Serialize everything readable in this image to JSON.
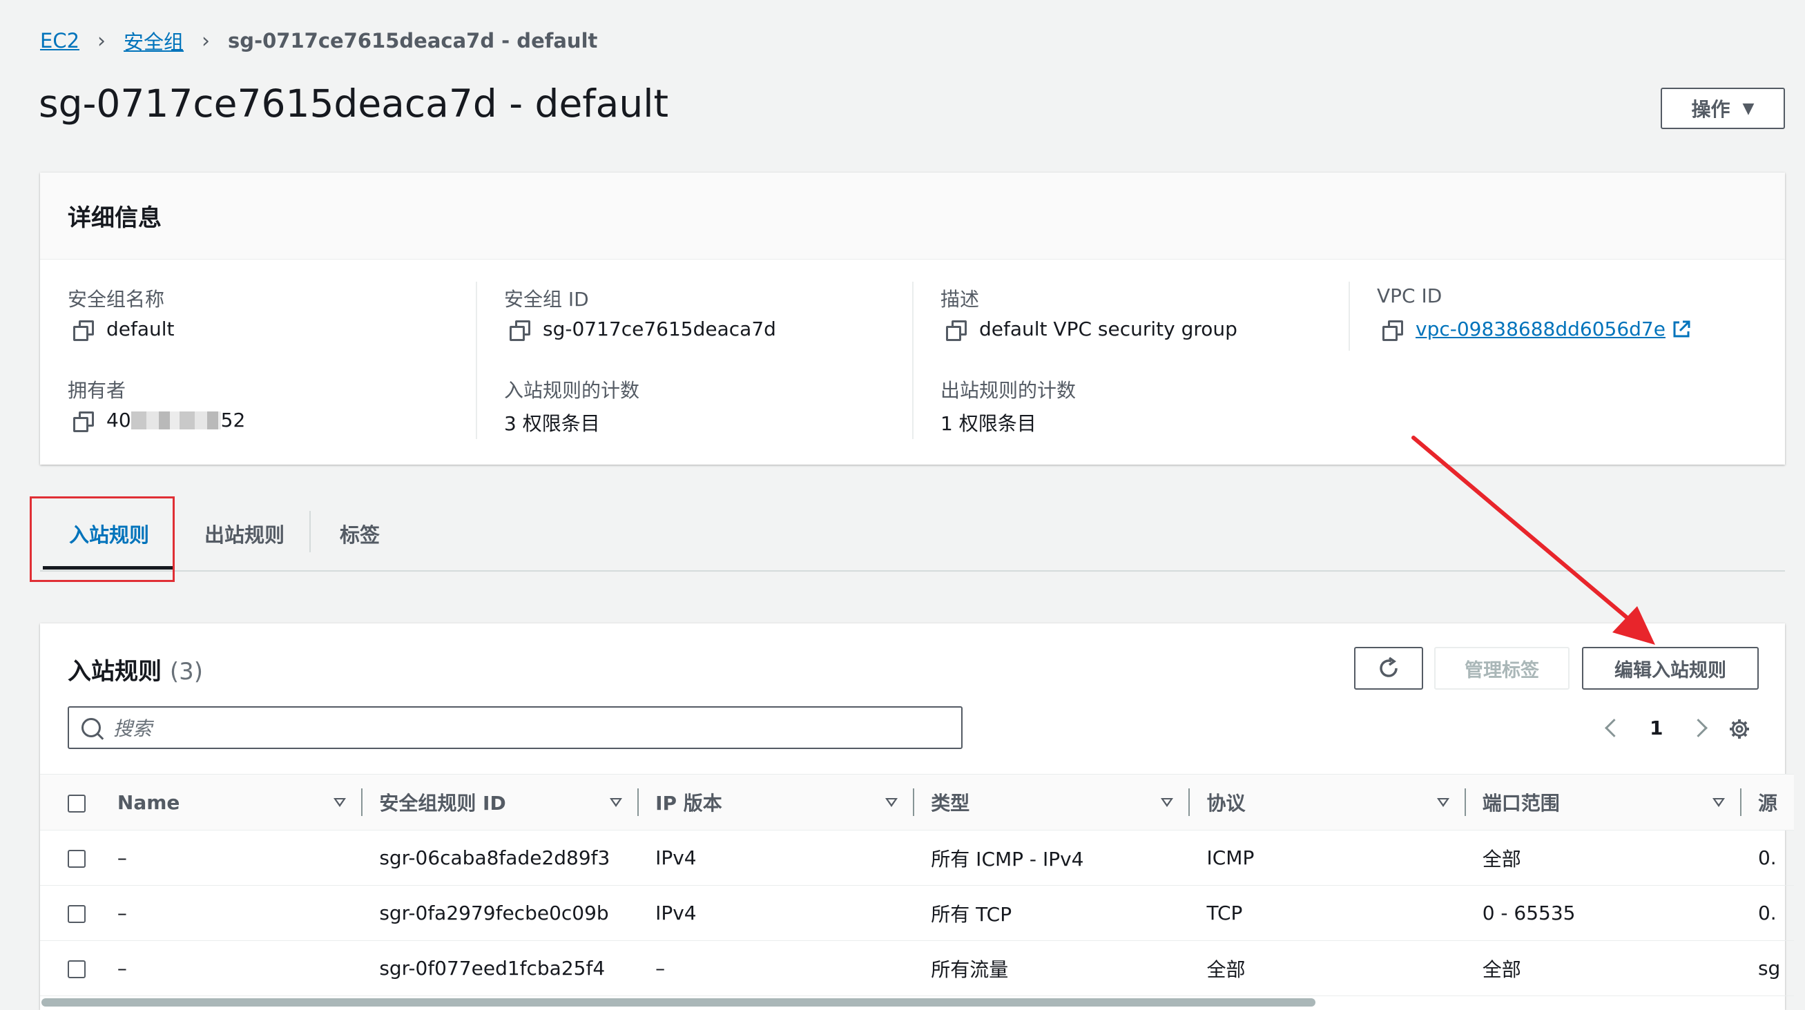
{
  "breadcrumb": {
    "items": [
      "EC2",
      "安全组"
    ],
    "current": "sg-0717ce7615deaca7d - default"
  },
  "page_title": "sg-0717ce7615deaca7d - default",
  "actions_label": "操作",
  "details": {
    "title": "详细信息",
    "fields": {
      "name_label": "安全组名称",
      "name_value": "default",
      "id_label": "安全组 ID",
      "id_value": "sg-0717ce7615deaca7d",
      "desc_label": "描述",
      "desc_value": "default VPC security group",
      "vpc_label": "VPC ID",
      "vpc_value": "vpc-09838688dd6056d7e",
      "owner_label": "拥有者",
      "owner_prefix": "40",
      "owner_suffix": "52",
      "inbound_count_label": "入站规则的计数",
      "inbound_count_value": "3 权限条目",
      "outbound_count_label": "出站规则的计数",
      "outbound_count_value": "1 权限条目"
    }
  },
  "tabs": [
    "入站规则",
    "出站规则",
    "标签"
  ],
  "rules_panel": {
    "title": "入站规则",
    "count": "(3)",
    "manage_tags_label": "管理标签",
    "edit_label": "编辑入站规则",
    "search_placeholder": "搜索",
    "page_number": "1",
    "columns": [
      "Name",
      "安全组规则 ID",
      "IP 版本",
      "类型",
      "协议",
      "端口范围",
      "源"
    ],
    "rows": [
      [
        "–",
        "sgr-06caba8fade2d89f3",
        "IPv4",
        "所有 ICMP - IPv4",
        "ICMP",
        "全部",
        "0."
      ],
      [
        "–",
        "sgr-0fa2979fecbe0c09b",
        "IPv4",
        "所有 TCP",
        "TCP",
        "0 - 65535",
        "0."
      ],
      [
        "–",
        "sgr-0f077eed1fcba25f4",
        "–",
        "所有流量",
        "全部",
        "全部",
        "sg"
      ]
    ]
  },
  "colors": {
    "link": "#0073bb",
    "highlight": "#e02f35",
    "arrow": "#e8252b"
  }
}
